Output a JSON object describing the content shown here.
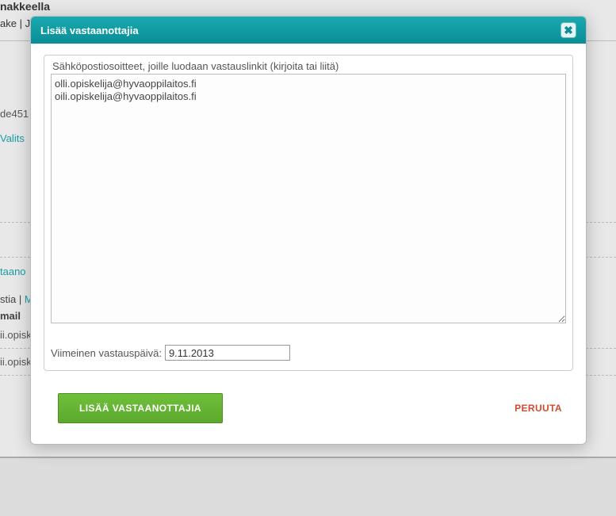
{
  "background": {
    "heading_fragment": "nakkeella",
    "link1": "ake",
    "sep": " | ",
    "link2_letter": "J",
    "code_fragment": "de451",
    "valitse": "Valits",
    "taano": "taano",
    "stia": "stia",
    "m_frag": "M",
    "mail": "mail",
    "row1": "ii.opisk",
    "row2": "ii.opisk"
  },
  "dialog": {
    "title": "Lisää vastaanottajia",
    "email_label": "Sähköpostiosoitteet, joille luodaan vastauslinkit (kirjoita tai liitä)",
    "email_value": "olli.opiskelija@hyvaoppilaitos.fi\noili.opiskelija@hyvaoppilaitos.fi",
    "date_label": "Viimeinen vastauspäivä:",
    "date_value": "9.11.2013",
    "submit_label": "LISÄÄ VASTAANOTTAJIA",
    "cancel_label": "PERUUTA"
  }
}
